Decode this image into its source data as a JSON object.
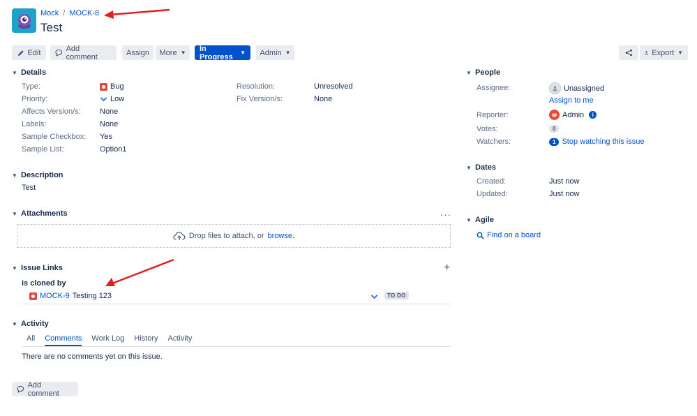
{
  "breadcrumb": {
    "project": "Mock",
    "issue_key": "MOCK-8"
  },
  "issue": {
    "title": "Test"
  },
  "toolbar": {
    "edit": "Edit",
    "add_comment": "Add comment",
    "assign": "Assign",
    "more": "More",
    "status": "In Progress",
    "admin": "Admin",
    "export": "Export"
  },
  "details": {
    "heading": "Details",
    "type_label": "Type:",
    "type_value": "Bug",
    "priority_label": "Priority:",
    "priority_value": "Low",
    "affects_label": "Affects Version/s:",
    "affects_value": "None",
    "labels_label": "Labels:",
    "labels_value": "None",
    "checkbox_label": "Sample Checkbox:",
    "checkbox_value": "Yes",
    "list_label": "Sample List:",
    "list_value": "Option1",
    "resolution_label": "Resolution:",
    "resolution_value": "Unresolved",
    "fix_label": "Fix Version/s:",
    "fix_value": "None"
  },
  "description": {
    "heading": "Description",
    "text": "Test"
  },
  "attachments": {
    "heading": "Attachments",
    "drop_text": "Drop files to attach, or",
    "browse": "browse."
  },
  "issue_links": {
    "heading": "Issue Links",
    "relation": "is cloned by",
    "linked_key": "MOCK-9",
    "linked_summary": "Testing 123",
    "linked_status": "TO DO"
  },
  "activity": {
    "heading": "Activity",
    "tabs": [
      "All",
      "Comments",
      "Work Log",
      "History",
      "Activity"
    ],
    "empty_text": "There are no comments yet on this issue.",
    "add_comment": "Add comment"
  },
  "people": {
    "heading": "People",
    "assignee_label": "Assignee:",
    "assignee_value": "Unassigned",
    "assign_to_me": "Assign to me",
    "reporter_label": "Reporter:",
    "reporter_value": "Admin",
    "votes_label": "Votes:",
    "votes_value": "0",
    "watchers_label": "Watchers:",
    "watchers_count": "1",
    "watchers_action": "Stop watching this issue"
  },
  "dates": {
    "heading": "Dates",
    "created_label": "Created:",
    "created_value": "Just now",
    "updated_label": "Updated:",
    "updated_value": "Just now"
  },
  "agile": {
    "heading": "Agile",
    "find_board": "Find on a board"
  },
  "colors": {
    "accent": "#0052cc",
    "bug": "#e5493a",
    "project_avatar": "#1fa3c4",
    "annotation_arrow": "#e02020"
  }
}
